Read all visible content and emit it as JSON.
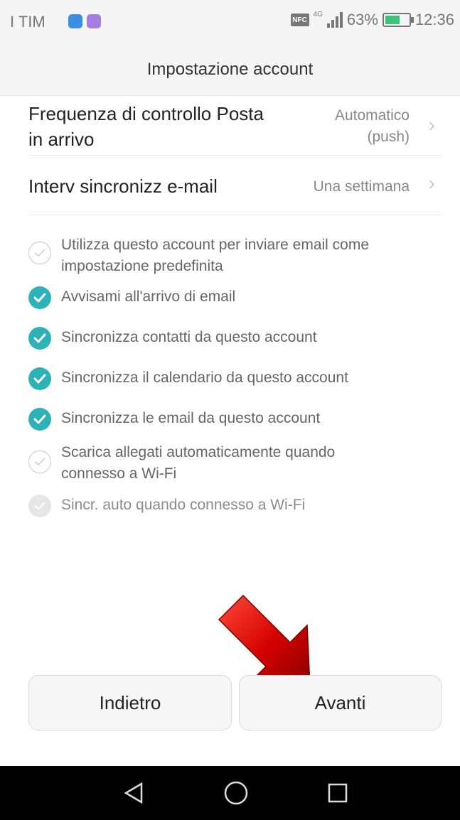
{
  "status_bar": {
    "carrier": "I TIM",
    "battery_percent": "63%",
    "battery_level": 0.63,
    "time": "12:36",
    "nfc_label": "NFC",
    "network_label": "4G",
    "icons": [
      "notification-blue-icon",
      "notification-purple-icon",
      "nfc-icon",
      "signal-icon",
      "battery-icon"
    ]
  },
  "header": {
    "title": "Impostazione account"
  },
  "settings": [
    {
      "label_line1": "Frequenza di controllo Posta",
      "label_line2": "in arrivo",
      "value_line1": "Automatico",
      "value_line2": "(push)"
    },
    {
      "label_line1": "Interv sincronizz e-mail",
      "value_line1": "Una settimana"
    }
  ],
  "options": [
    {
      "line1": "Utilizza questo account per inviare email come",
      "line2": "impostazione predefinita",
      "state": "unchecked"
    },
    {
      "line1": "Avvisami all'arrivo di email",
      "state": "checked"
    },
    {
      "line1": "Sincronizza contatti da questo account",
      "state": "checked"
    },
    {
      "line1": "Sincronizza il calendario da questo account",
      "state": "checked"
    },
    {
      "line1": "Sincronizza le email da questo account",
      "state": "checked"
    },
    {
      "line1": "Scarica allegati automaticamente quando",
      "line2": "connesso a Wi-Fi",
      "state": "unchecked"
    },
    {
      "line1": "Sincr. auto quando connesso a Wi-Fi",
      "state": "disabled"
    }
  ],
  "buttons": {
    "back": "Indietro",
    "next": "Avanti"
  },
  "colors": {
    "accent": "#2db2b7",
    "arrow": "#d40000"
  }
}
